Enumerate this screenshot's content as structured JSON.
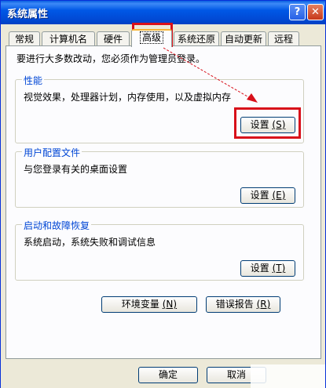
{
  "window": {
    "title": "系统属性"
  },
  "titlebar": {
    "help_label": "?",
    "close_label": "✕"
  },
  "tabs": [
    {
      "label": "常规"
    },
    {
      "label": "计算机名"
    },
    {
      "label": "硬件"
    },
    {
      "label": "高级"
    },
    {
      "label": "系统还原"
    },
    {
      "label": "自动更新"
    },
    {
      "label": "远程"
    }
  ],
  "intro_text": "要进行大多数改动，您必须作为管理员登录。",
  "groups": {
    "performance": {
      "title": "性能",
      "desc": "视觉效果，处理器计划，内存使用，以及虚拟内存",
      "button": "设置",
      "key": "(S)"
    },
    "user_profiles": {
      "title": "用户配置文件",
      "desc": "与您登录有关的桌面设置",
      "button": "设置",
      "key": "(E)"
    },
    "startup_recovery": {
      "title": "启动和故障恢复",
      "desc": "系统启动，系统失败和调试信息",
      "button": "设置",
      "key": "(T)"
    }
  },
  "buttons": {
    "env_vars": {
      "label": "环境变量",
      "key": "(N)"
    },
    "error_report": {
      "label": "错误报告",
      "key": "(R)"
    },
    "ok": "确定",
    "cancel": "取消"
  },
  "colors": {
    "annotation": "#d8101a",
    "group_title": "#0046d5",
    "titlebar": "#0058e6"
  }
}
